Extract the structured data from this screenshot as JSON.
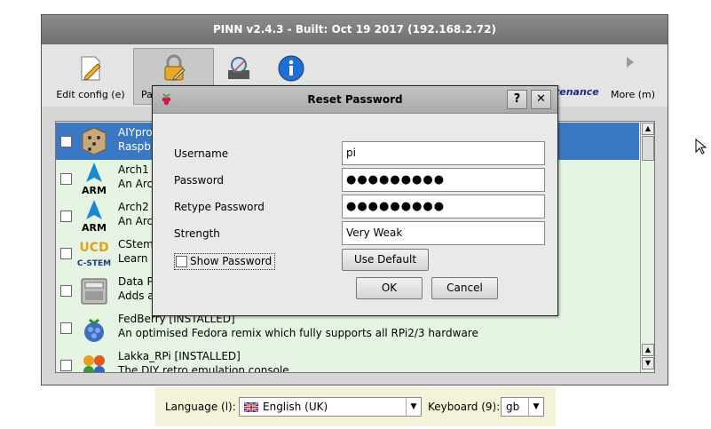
{
  "window": {
    "title": "PINN v2.4.3 - Built: Oct 19 2017 (192.168.2.72)"
  },
  "toolbar": {
    "edit_config": "Edit config (e)",
    "password": "Pa",
    "maintenance": "Maintenance",
    "more": "More (m)"
  },
  "os_list": [
    {
      "title": "AIYpro",
      "desc": "Raspbi",
      "icon": "aiy-cube-icon",
      "selected": true
    },
    {
      "title": "Arch1",
      "desc": "An Arc",
      "icon": "arm-logo-icon"
    },
    {
      "title": "Arch2",
      "desc": "An Arc",
      "icon": "arm-logo-icon"
    },
    {
      "title": "CStem",
      "desc": "Learn",
      "icon": "ucd-cstem-icon"
    },
    {
      "title": "Data P",
      "desc": "Adds a",
      "icon": "data-partition-icon"
    },
    {
      "title": "FedBerry [INSTALLED]",
      "desc": "An optimised Fedora remix which fully supports all RPi2/3 hardware",
      "icon": "fedberry-icon"
    },
    {
      "title": "Lakka_RPi [INSTALLED]",
      "desc": "The DIY retro emulation console",
      "icon": "lakka-flower-icon"
    }
  ],
  "icon_text": {
    "arm": "ARM",
    "ucd": "UCD",
    "cstem": "C-STEM"
  },
  "scroll_arrows": {
    "up": "▲",
    "down": "▼"
  },
  "bottom": {
    "language_label": "Language (l):",
    "language_value": "English (UK)",
    "keyboard_label": "Keyboard (9):",
    "keyboard_value": "gb",
    "arrow": "▼"
  },
  "dialog": {
    "title": "Reset Password",
    "help": "?",
    "close": "✕",
    "username_label": "Username",
    "username_value": "pi",
    "password_label": "Password",
    "password_value": "●●●●●●●●●",
    "retype_label": "Retype Password",
    "retype_value": "●●●●●●●●●",
    "strength_label": "Strength",
    "strength_value": "Very Weak",
    "show_password": "Show Password",
    "use_default": "Use Default",
    "ok": "OK",
    "cancel": "Cancel"
  },
  "colors": {
    "accent": "#3a78c4",
    "list_bg": "#e6f4e3",
    "title_bar": "#7d7d7d"
  }
}
